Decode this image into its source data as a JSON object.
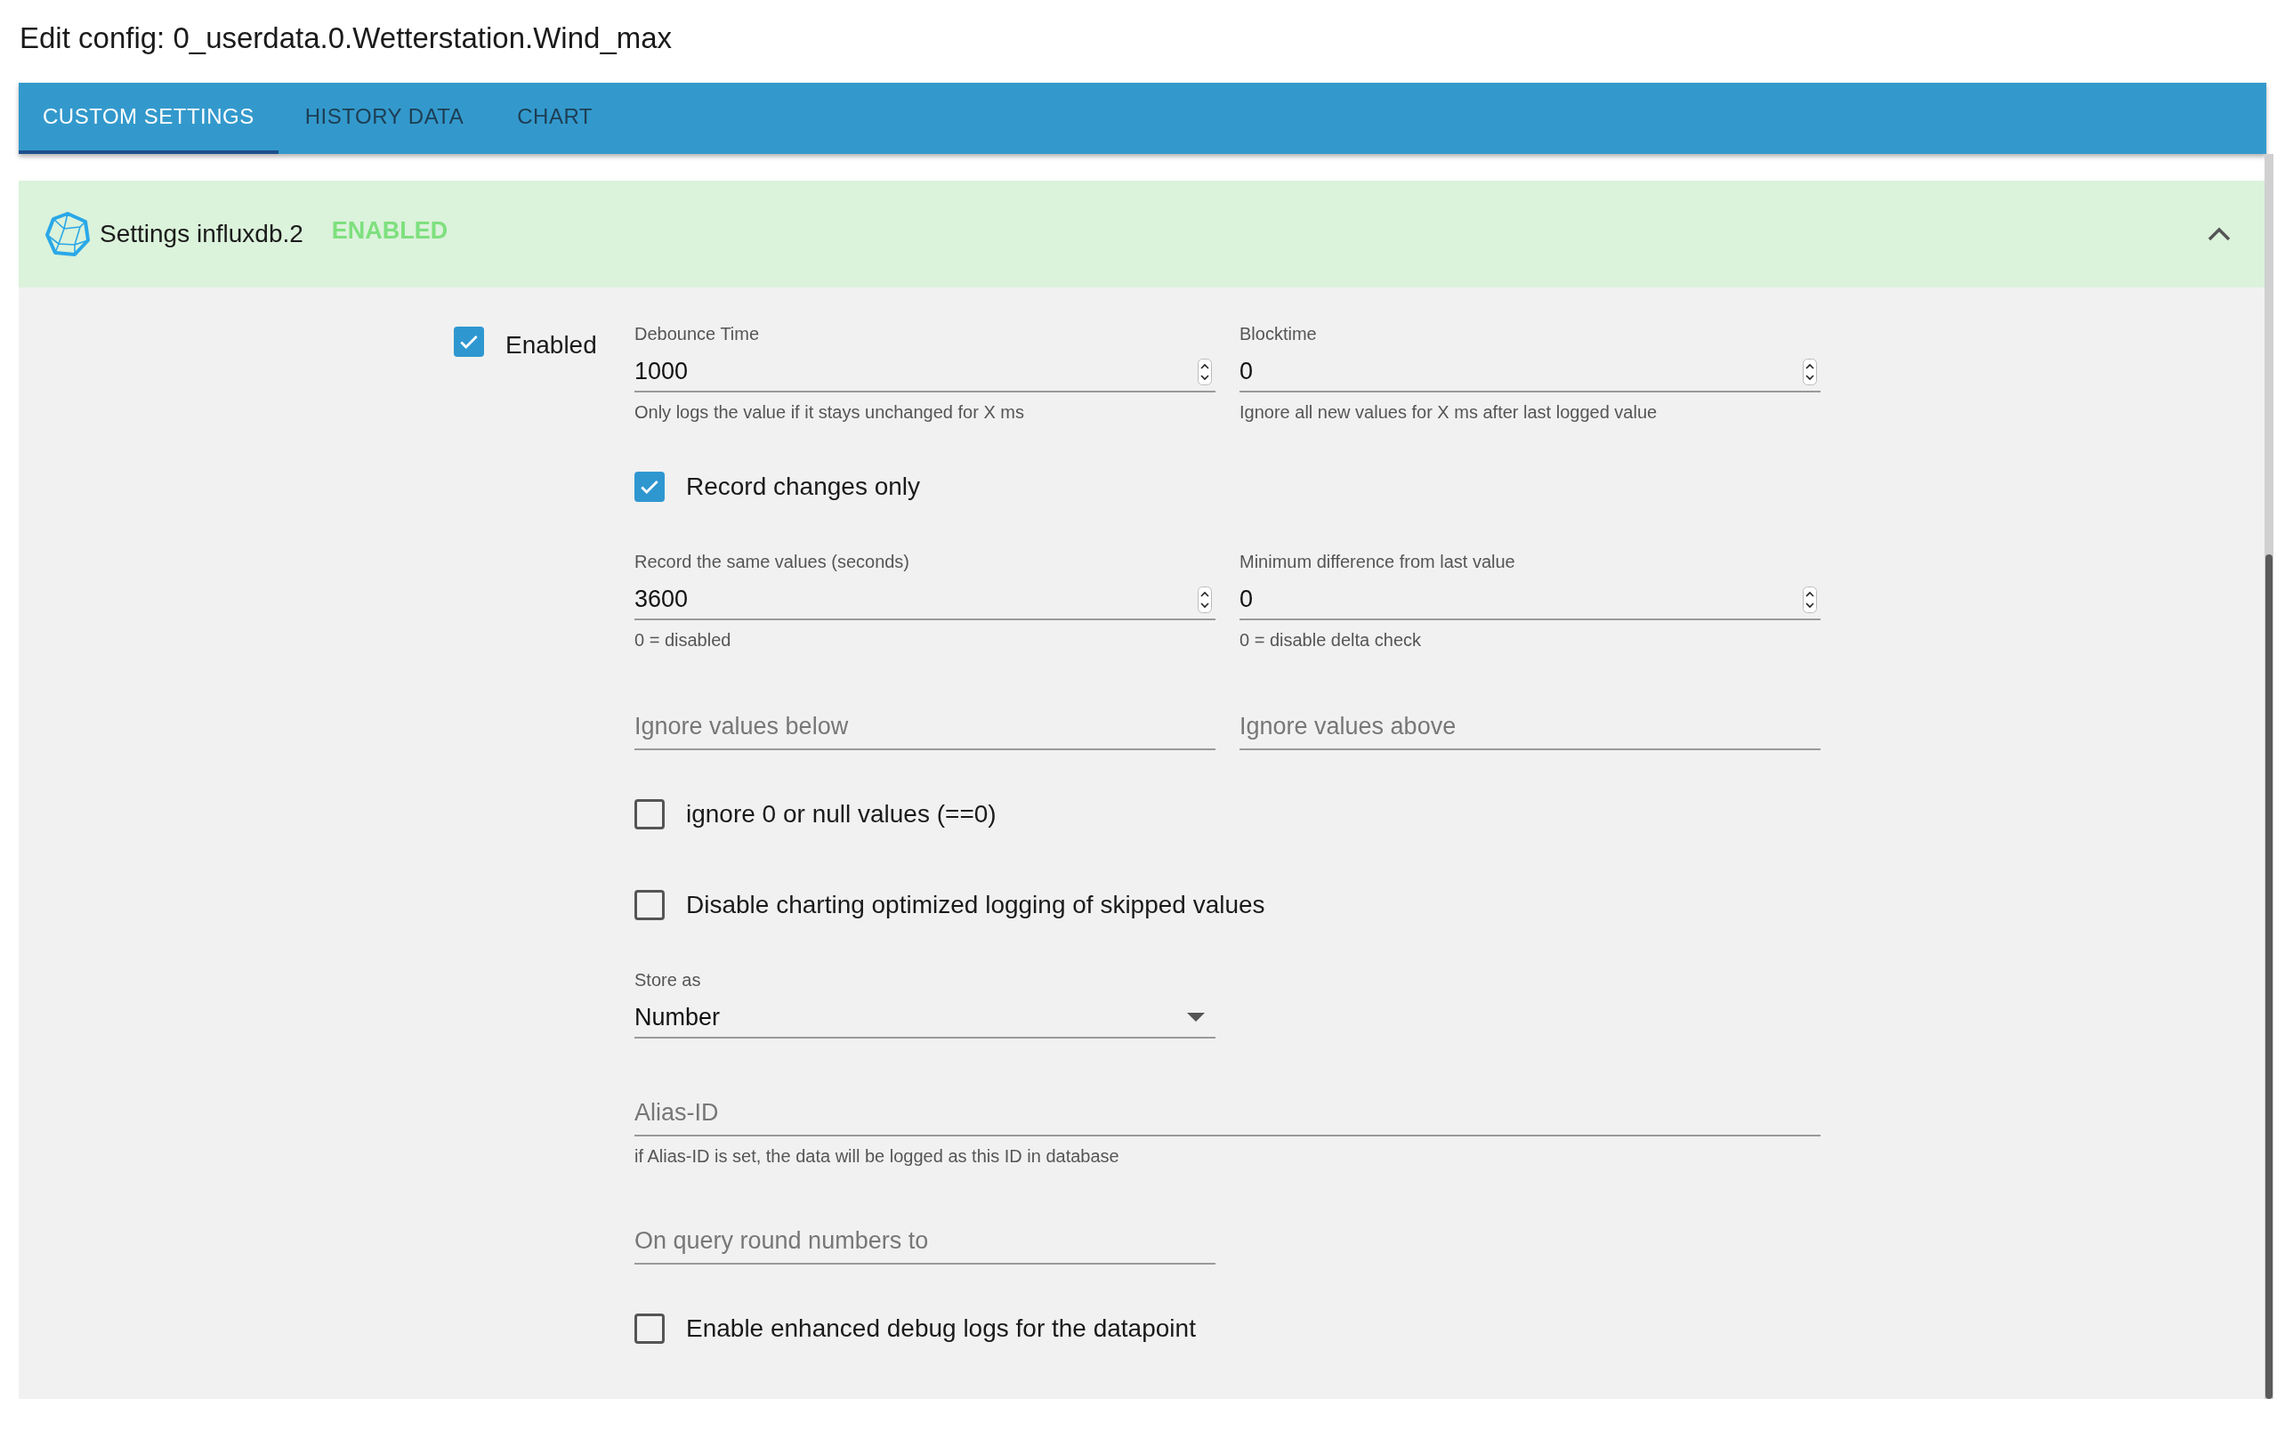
{
  "title": "Edit config: 0_userdata.0.Wetterstation.Wind_max",
  "tabs": [
    {
      "label": "CUSTOM SETTINGS",
      "selected": true
    },
    {
      "label": "HISTORY DATA",
      "selected": false
    },
    {
      "label": "CHART",
      "selected": false
    }
  ],
  "panel": {
    "title": "Settings influxdb.2",
    "status": "ENABLED",
    "expanded": true
  },
  "enabled": {
    "label": "Enabled",
    "checked": true
  },
  "form": [
    {
      "kind": "pair",
      "fields": [
        {
          "kind": "number",
          "label": "Debounce Time",
          "value": "1000",
          "helper": "Only logs the value if it stays unchanged for X ms"
        },
        {
          "kind": "number",
          "label": "Blocktime",
          "value": "0",
          "helper": "Ignore all new values for X ms after last logged value"
        }
      ]
    },
    {
      "kind": "checkbox",
      "label": "Record changes only",
      "checked": true
    },
    {
      "kind": "pair",
      "fields": [
        {
          "kind": "number",
          "label": "Record the same values (seconds)",
          "value": "3600",
          "helper": "0 = disabled"
        },
        {
          "kind": "number",
          "label": "Minimum difference from last value",
          "value": "0",
          "helper": "0 = disable delta check"
        }
      ]
    },
    {
      "kind": "pair",
      "fields": [
        {
          "kind": "text",
          "placeholder": "Ignore values below"
        },
        {
          "kind": "text",
          "placeholder": "Ignore values above"
        }
      ]
    },
    {
      "kind": "checkbox",
      "label": "ignore 0 or null values (==0)",
      "checked": false
    },
    {
      "kind": "checkbox",
      "label": "Disable charting optimized logging of skipped values",
      "checked": false
    },
    {
      "kind": "select",
      "label": "Store as",
      "value": "Number"
    },
    {
      "kind": "wide",
      "placeholder": "Alias-ID",
      "helper": "if Alias-ID is set, the data will be logged as this ID in database"
    },
    {
      "kind": "half",
      "placeholder": "On query round numbers to"
    },
    {
      "kind": "checkbox",
      "label": "Enable enhanced debug logs for the datapoint",
      "checked": false
    }
  ]
}
